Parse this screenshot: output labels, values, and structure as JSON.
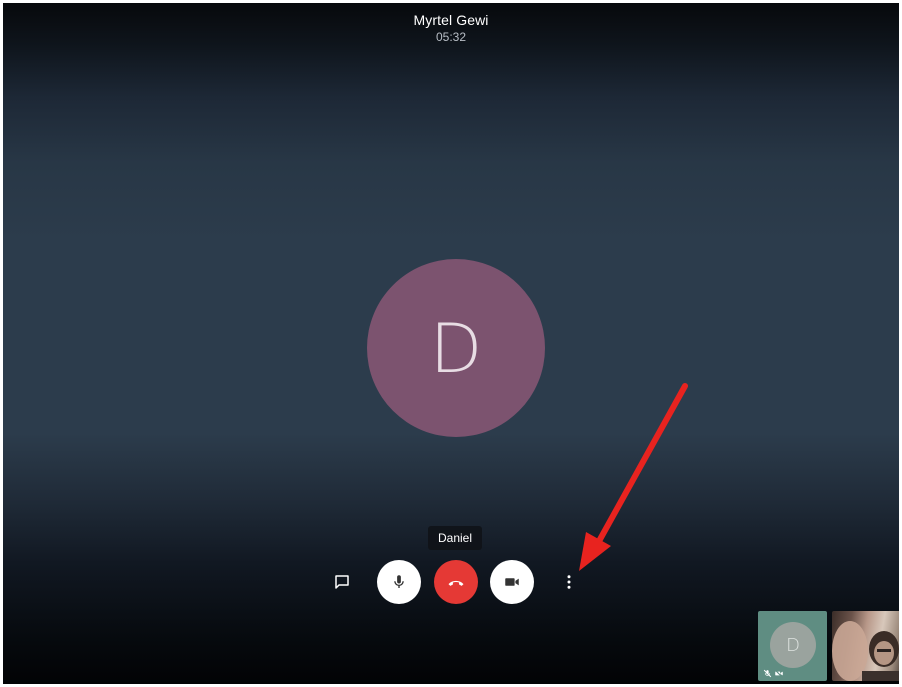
{
  "call": {
    "caller_name": "Myrtel Gewi",
    "duration": "05:32"
  },
  "participant": {
    "initial": "D",
    "avatar_color": "#7c536f",
    "tooltip_name": "Daniel"
  },
  "controls": {
    "chat_icon": "chat-bubble-icon",
    "mic_icon": "microphone-icon",
    "hangup_icon": "phone-hangup-icon",
    "camera_icon": "video-camera-icon",
    "more_icon": "more-vertical-icon",
    "hangup_color": "#e53935"
  },
  "thumbnails": {
    "local_initial": "D",
    "local_color": "#5f8d82",
    "status_icons": [
      "mic-off-icon",
      "camera-off-icon"
    ]
  },
  "annotation": {
    "arrow_color": "#e8231f"
  }
}
